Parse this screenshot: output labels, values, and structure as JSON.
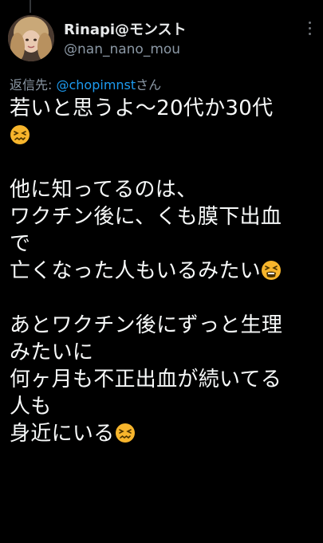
{
  "tweet": {
    "author_name": "Rinapi@モンスト",
    "author_handle": "@nan_nano_mou",
    "reply_prefix": "返信先: ",
    "reply_mention": "@chopimnst",
    "reply_suffix": "さん",
    "lines": {
      "l1": "若いと思うよ〜20代か30代",
      "l3": "他に知ってるのは、",
      "l4": "ワクチン後に、くも膜下出血",
      "l5": "で",
      "l6": "亡くなった人もいるみたい",
      "l8": "あとワクチン後にずっと生理",
      "l9": "みたいに",
      "l10": "何ヶ月も不正出血が続いてる",
      "l11": "人も",
      "l12": "身近にいる"
    },
    "emojis": {
      "confounded": "confounded-face-emoji",
      "tired": "tired-face-emoji"
    }
  },
  "colors": {
    "background": "#000000",
    "text": "#f7f9f9",
    "secondary": "#8b98a5",
    "link": "#1d9bf0",
    "emoji": "#f7b52c"
  }
}
